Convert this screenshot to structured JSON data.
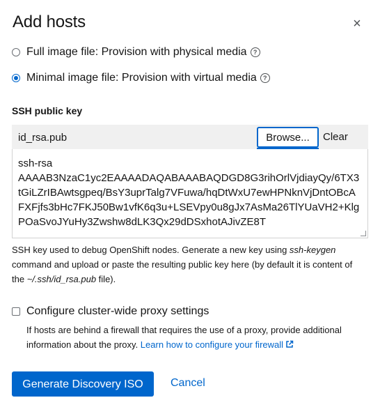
{
  "dialog": {
    "title": "Add hosts",
    "close_glyph": "×"
  },
  "image_type": {
    "options": [
      {
        "label": "Full image file: Provision with physical media",
        "selected": false
      },
      {
        "label": "Minimal image file: Provision with virtual media",
        "selected": true
      }
    ],
    "help_glyph": "?"
  },
  "ssh_key": {
    "label": "SSH public key",
    "filename": "id_rsa.pub",
    "browse_label": "Browse...",
    "clear_label": "Clear",
    "value": "ssh-rsa\nAAAAB3NzaC1yc2EAAAADAQABAAABAQDGD8G3rihOrlVjdiayQy/6TX3tGiLZrIBAwtsgpeq/BsY3uprTalg7VFuwa/hqDtWxU7ewHPNknVjDntOBcAFXFjfs3bHc7FKJ50Bw1vfK6q3u+LSEVpy0u8gJx7AsMa26TlYUaVH2+KlgPOaSvoJYuHy3Zwshw8dLK3Qx29dDSxhotAJivZE8T",
    "helper": {
      "part1": "SSH key used to debug OpenShift nodes. Generate a new key using ",
      "keygen": "ssh-keygen",
      "part2": " command and upload or paste the resulting public key here (by default it is content of the ",
      "path": "~/.ssh/id_rsa.pub",
      "part3": " file)."
    }
  },
  "proxy": {
    "checkbox_label": "Configure cluster-wide proxy settings",
    "checked": false,
    "description": "If hosts are behind a firewall that requires the use of a proxy, provide additional information about the proxy. ",
    "link_label": "Learn how to configure your firewall",
    "link_icon": "external-link-icon"
  },
  "footer": {
    "primary_label": "Generate Discovery ISO",
    "cancel_label": "Cancel"
  },
  "colors": {
    "accent": "#0066cc",
    "text": "#151515",
    "file_bar_bg": "#f0f0f0"
  }
}
